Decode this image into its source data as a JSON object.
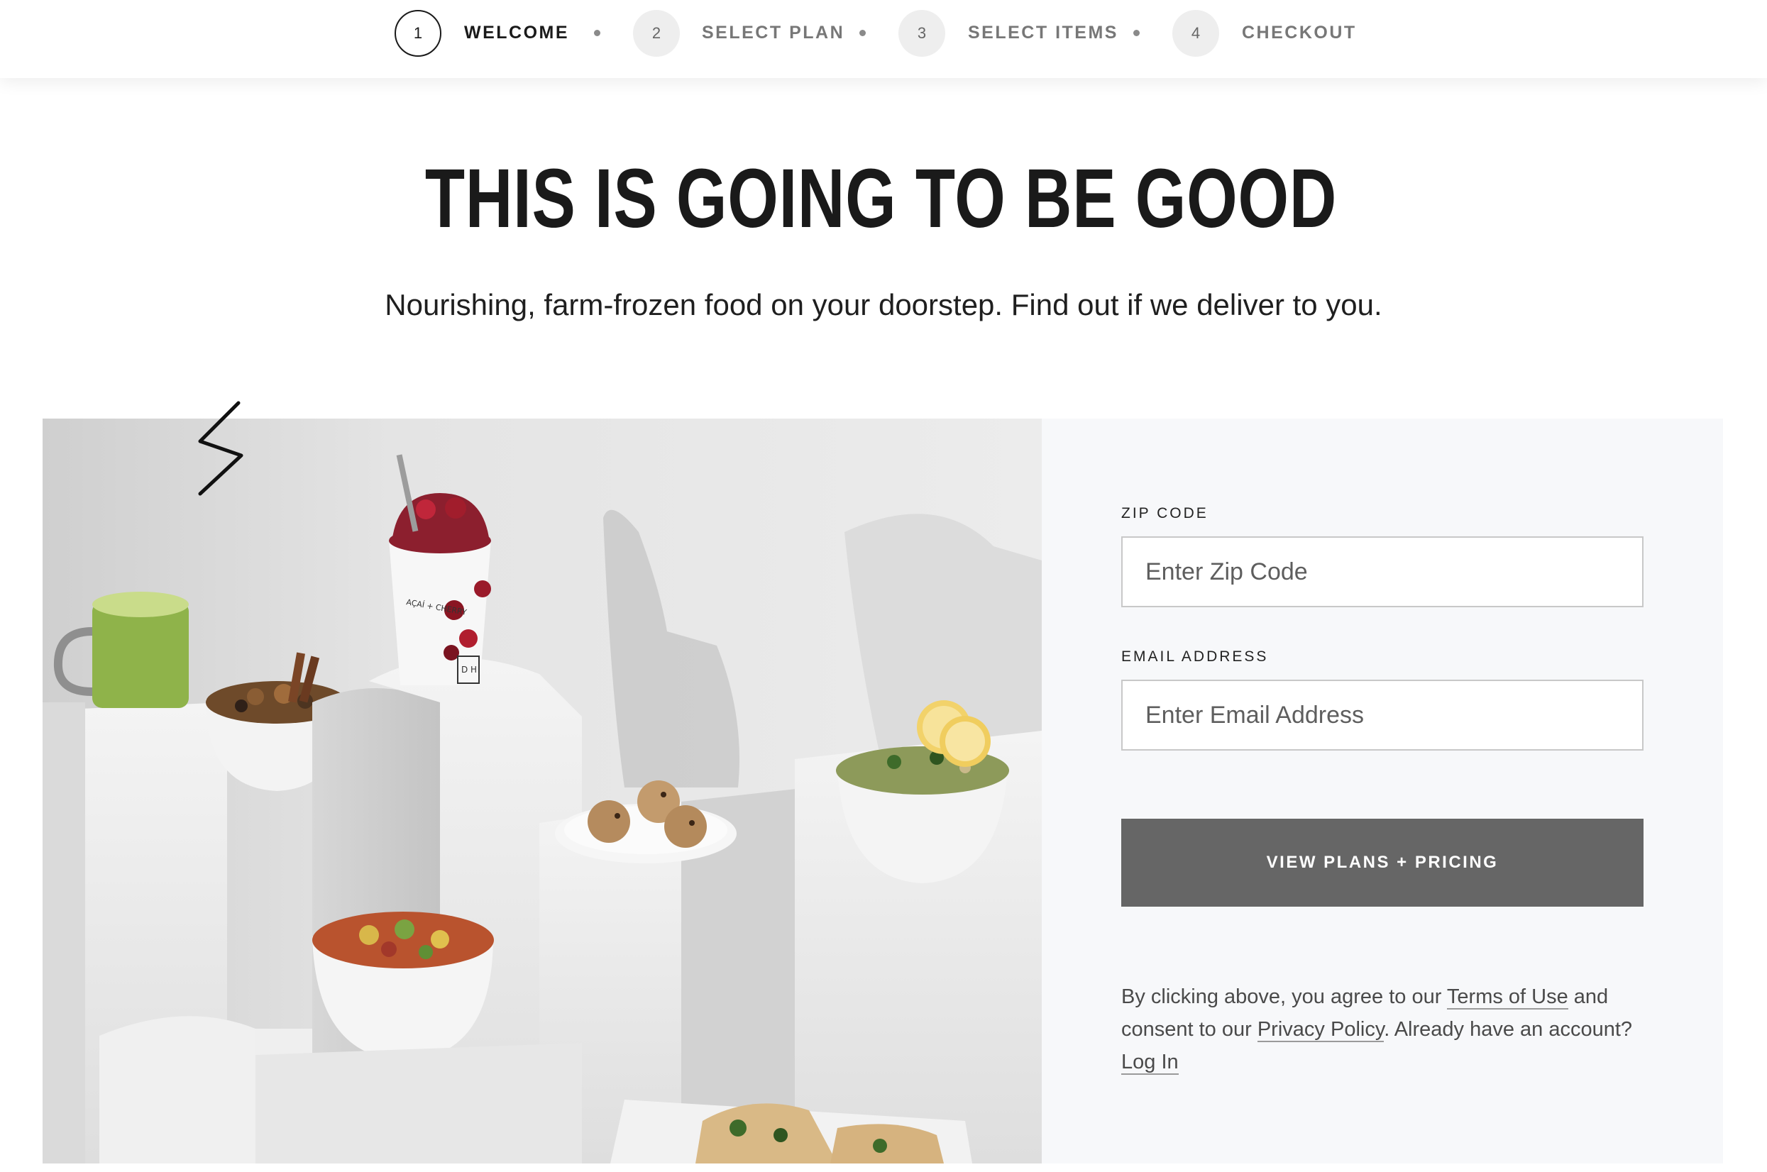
{
  "stepper": {
    "steps": [
      {
        "number": "1",
        "label": "WELCOME",
        "active": true
      },
      {
        "number": "2",
        "label": "SELECT PLAN",
        "active": false
      },
      {
        "number": "3",
        "label": "SELECT ITEMS",
        "active": false
      },
      {
        "number": "4",
        "label": "CHECKOUT",
        "active": false
      }
    ]
  },
  "hero": {
    "title": "THIS IS GOING TO BE GOOD",
    "subtitle": "Nourishing, farm-frozen food on your doorstep. Find out if we deliver to you."
  },
  "photo": {
    "cup_text_1": "AÇAÍ + CHERRY",
    "cup_logo": "D H"
  },
  "form": {
    "zip_label": "ZIP CODE",
    "zip_placeholder": "Enter Zip Code",
    "zip_value": "",
    "email_label": "EMAIL ADDRESS",
    "email_placeholder": "Enter Email Address",
    "email_value": "",
    "cta_label": "VIEW PLANS + PRICING",
    "legal": {
      "prefix": "By clicking above, you agree to our ",
      "terms_link": "Terms of Use",
      "middle": " and consent to our ",
      "privacy_link": "Privacy Policy",
      "suffix": ". Already have an account? ",
      "login_link": "Log In"
    }
  },
  "colors": {
    "cta_background": "#666666",
    "form_panel_background": "#f7f8fa",
    "text_primary": "#1a1a1a"
  },
  "icons": [
    "lightning-bolt-icon"
  ]
}
